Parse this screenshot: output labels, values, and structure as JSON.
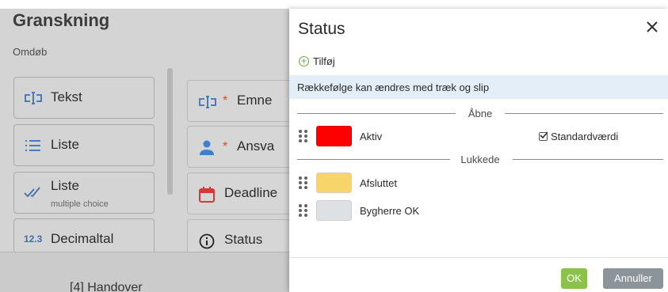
{
  "background": {
    "title": "Granskning",
    "rename_label": "Omdøb",
    "field_types": [
      {
        "label": "Tekst",
        "icon": "text-field-icon"
      },
      {
        "label": "Liste",
        "icon": "list-icon"
      },
      {
        "label": "Liste",
        "sublabel": "multiple choice",
        "icon": "double-check-icon"
      },
      {
        "label": "Decimaltal",
        "icon": "decimal-number-icon",
        "icon_text": "12.3"
      }
    ],
    "form_fields": [
      {
        "label": "Emne",
        "required": true,
        "icon": "text-field-icon"
      },
      {
        "label": "Ansva",
        "required": true,
        "icon": "person-icon"
      },
      {
        "label": "Deadline",
        "required": false,
        "icon": "calendar-icon"
      },
      {
        "label": "Status",
        "required": false,
        "icon": "info-icon"
      }
    ],
    "required_marker": "*",
    "partial_bottom_text": "[4] Handover"
  },
  "dialog": {
    "title": "Status",
    "add_label": "Tilføj",
    "info_text": "Rækkefølge kan ændres med træk og slip",
    "groups": [
      {
        "label": "Åbne",
        "items": [
          {
            "name": "Aktiv",
            "color": "#ff0000",
            "default": true
          }
        ]
      },
      {
        "label": "Lukkede",
        "items": [
          {
            "name": "Afsluttet",
            "color": "#f8d56b",
            "default": false
          },
          {
            "name": "Bygherre OK",
            "color": "#dde1e4",
            "default": false
          }
        ]
      }
    ],
    "default_label": "Standardværdi",
    "ok_label": "OK",
    "cancel_label": "Annuller",
    "accent_color": "#8bc34a",
    "info_bg_color": "#e4eef9"
  }
}
